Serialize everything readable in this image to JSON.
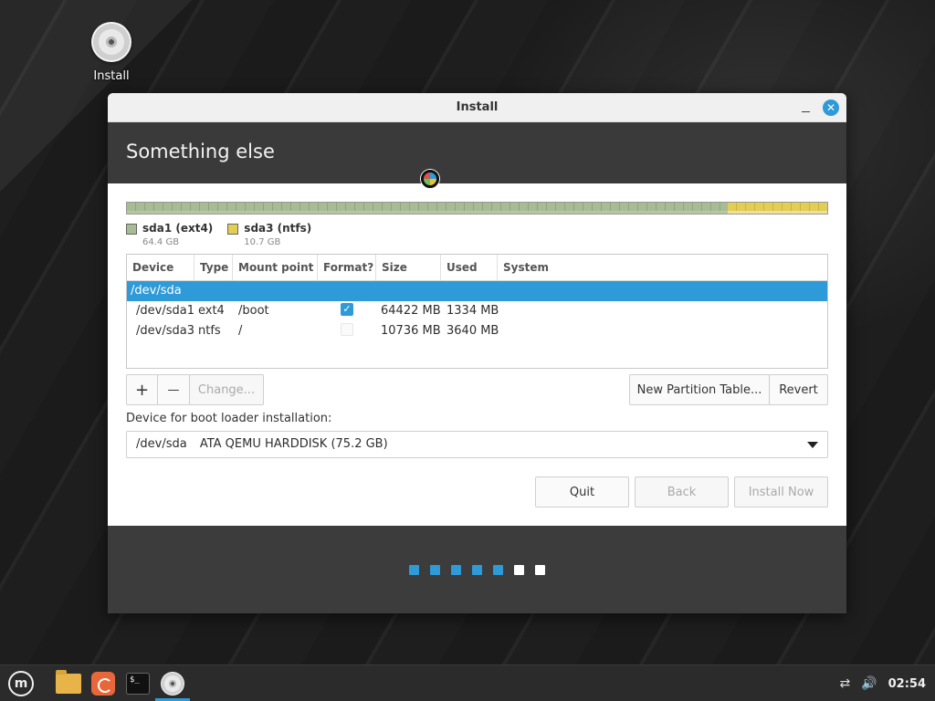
{
  "desktop": {
    "icon_label": "Install"
  },
  "window": {
    "title": "Install",
    "header_title": "Something else"
  },
  "partitions": {
    "legend": [
      {
        "name": "sda1 (ext4)",
        "size": "64.4 GB",
        "color": "#a7bc94"
      },
      {
        "name": "sda3 (ntfs)",
        "size": "10.7 GB",
        "color": "#e2cd55"
      }
    ]
  },
  "table": {
    "columns": [
      "Device",
      "Type",
      "Mount point",
      "Format?",
      "Size",
      "Used",
      "System"
    ],
    "selected_row": "/dev/sda",
    "rows": [
      {
        "device": "/dev/sda1",
        "type": "ext4",
        "mount": "/boot",
        "format": true,
        "size": "64422 MB",
        "used": "1334 MB",
        "system": ""
      },
      {
        "device": "/dev/sda3",
        "type": "ntfs",
        "mount": "/",
        "format": false,
        "size": "10736 MB",
        "used": "3640 MB",
        "system": ""
      }
    ]
  },
  "toolbar": {
    "add_label": "+",
    "remove_label": "—",
    "change_label": "Change...",
    "new_table_label": "New Partition Table...",
    "revert_label": "Revert"
  },
  "bootloader": {
    "label": "Device for boot loader installation:",
    "device": "/dev/sda",
    "description": "ATA QEMU HARDDISK (75.2 GB)"
  },
  "actions": {
    "quit_label": "Quit",
    "back_label": "Back",
    "install_label": "Install Now"
  },
  "progress": {
    "steps_total": 7,
    "steps_done": 5,
    "done_color": "#2e9ad8",
    "pending_color": "#ffffff"
  },
  "taskbar": {
    "clock": "02:54",
    "accent": "#2e9ad8"
  }
}
